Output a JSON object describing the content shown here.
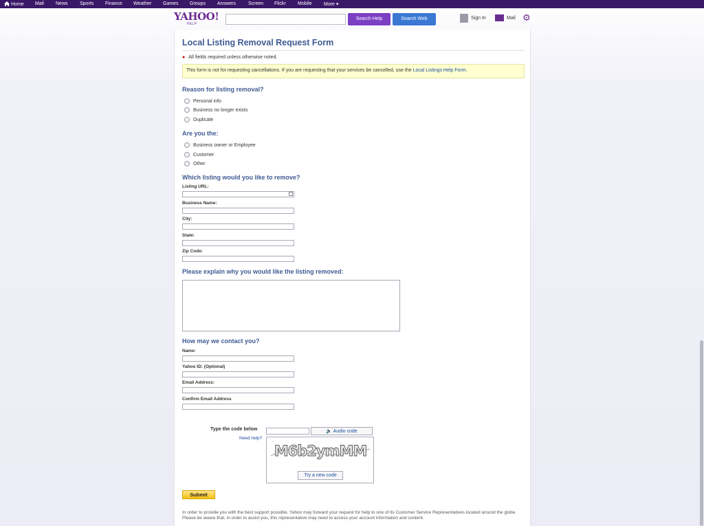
{
  "topnav": {
    "items": [
      "Home",
      "Mail",
      "News",
      "Sports",
      "Finance",
      "Weather",
      "Games",
      "Groups",
      "Answers",
      "Screen",
      "Flickr",
      "Mobile",
      "More"
    ]
  },
  "header": {
    "logo_text": "YAHOO!",
    "logo_sub": "HELP",
    "search_help_label": "Search Help",
    "search_web_label": "Search Web",
    "sign_in_label": "Sign In",
    "mail_label": "Mail"
  },
  "form": {
    "title": "Local Listing Removal Request Form",
    "required_note": "All fields required unless otherwise noted.",
    "notice_text": "This form is not for requesting cancellations. If you are requesting that your services be cancelled, use the ",
    "notice_link": "Local Listings Help Form",
    "notice_end": ".",
    "reason_heading": "Reason for listing removal?",
    "reason_options": [
      "Personal info",
      "Business no longer exists",
      "Duplicate"
    ],
    "role_heading": "Are you the:",
    "role_options": [
      "Business owner or Employee",
      "Customer",
      "Other"
    ],
    "listing_heading": "Which listing would you like to remove?",
    "listing_fields": [
      "Listing URL:",
      "Business Name:",
      "City:",
      "State:",
      "Zip Code:"
    ],
    "explain_heading": "Please explain why you would like the listing removed:",
    "contact_heading": "How may we contact you?",
    "contact_fields": [
      "Name:",
      "Yahoo ID: (Optional)",
      "Email Address:",
      "Confirm Email Address"
    ],
    "captcha_label": "Type the code below",
    "need_help": "Need help?",
    "audio_code": "Audio code",
    "captcha_text": "M6b2ymMM",
    "new_code": "Try a new code",
    "submit": "Submit",
    "disclaimer": "In order to provide you with the best support possible, Yahoo may forward your request for help to one of its Customer Service Representatives located around the globe. Please be aware that, in order to assist you, this representative may need to access your account information and content."
  },
  "colors": {
    "nav_bg": "#3a1868",
    "brand_purple": "#6b2c91",
    "heading_blue": "#3f5a93",
    "search_help_bg": "#7b3fc4",
    "search_web_bg": "#3a78d4",
    "notice_bg": "#ffffd0",
    "submit_bg": "#f6c10e"
  }
}
